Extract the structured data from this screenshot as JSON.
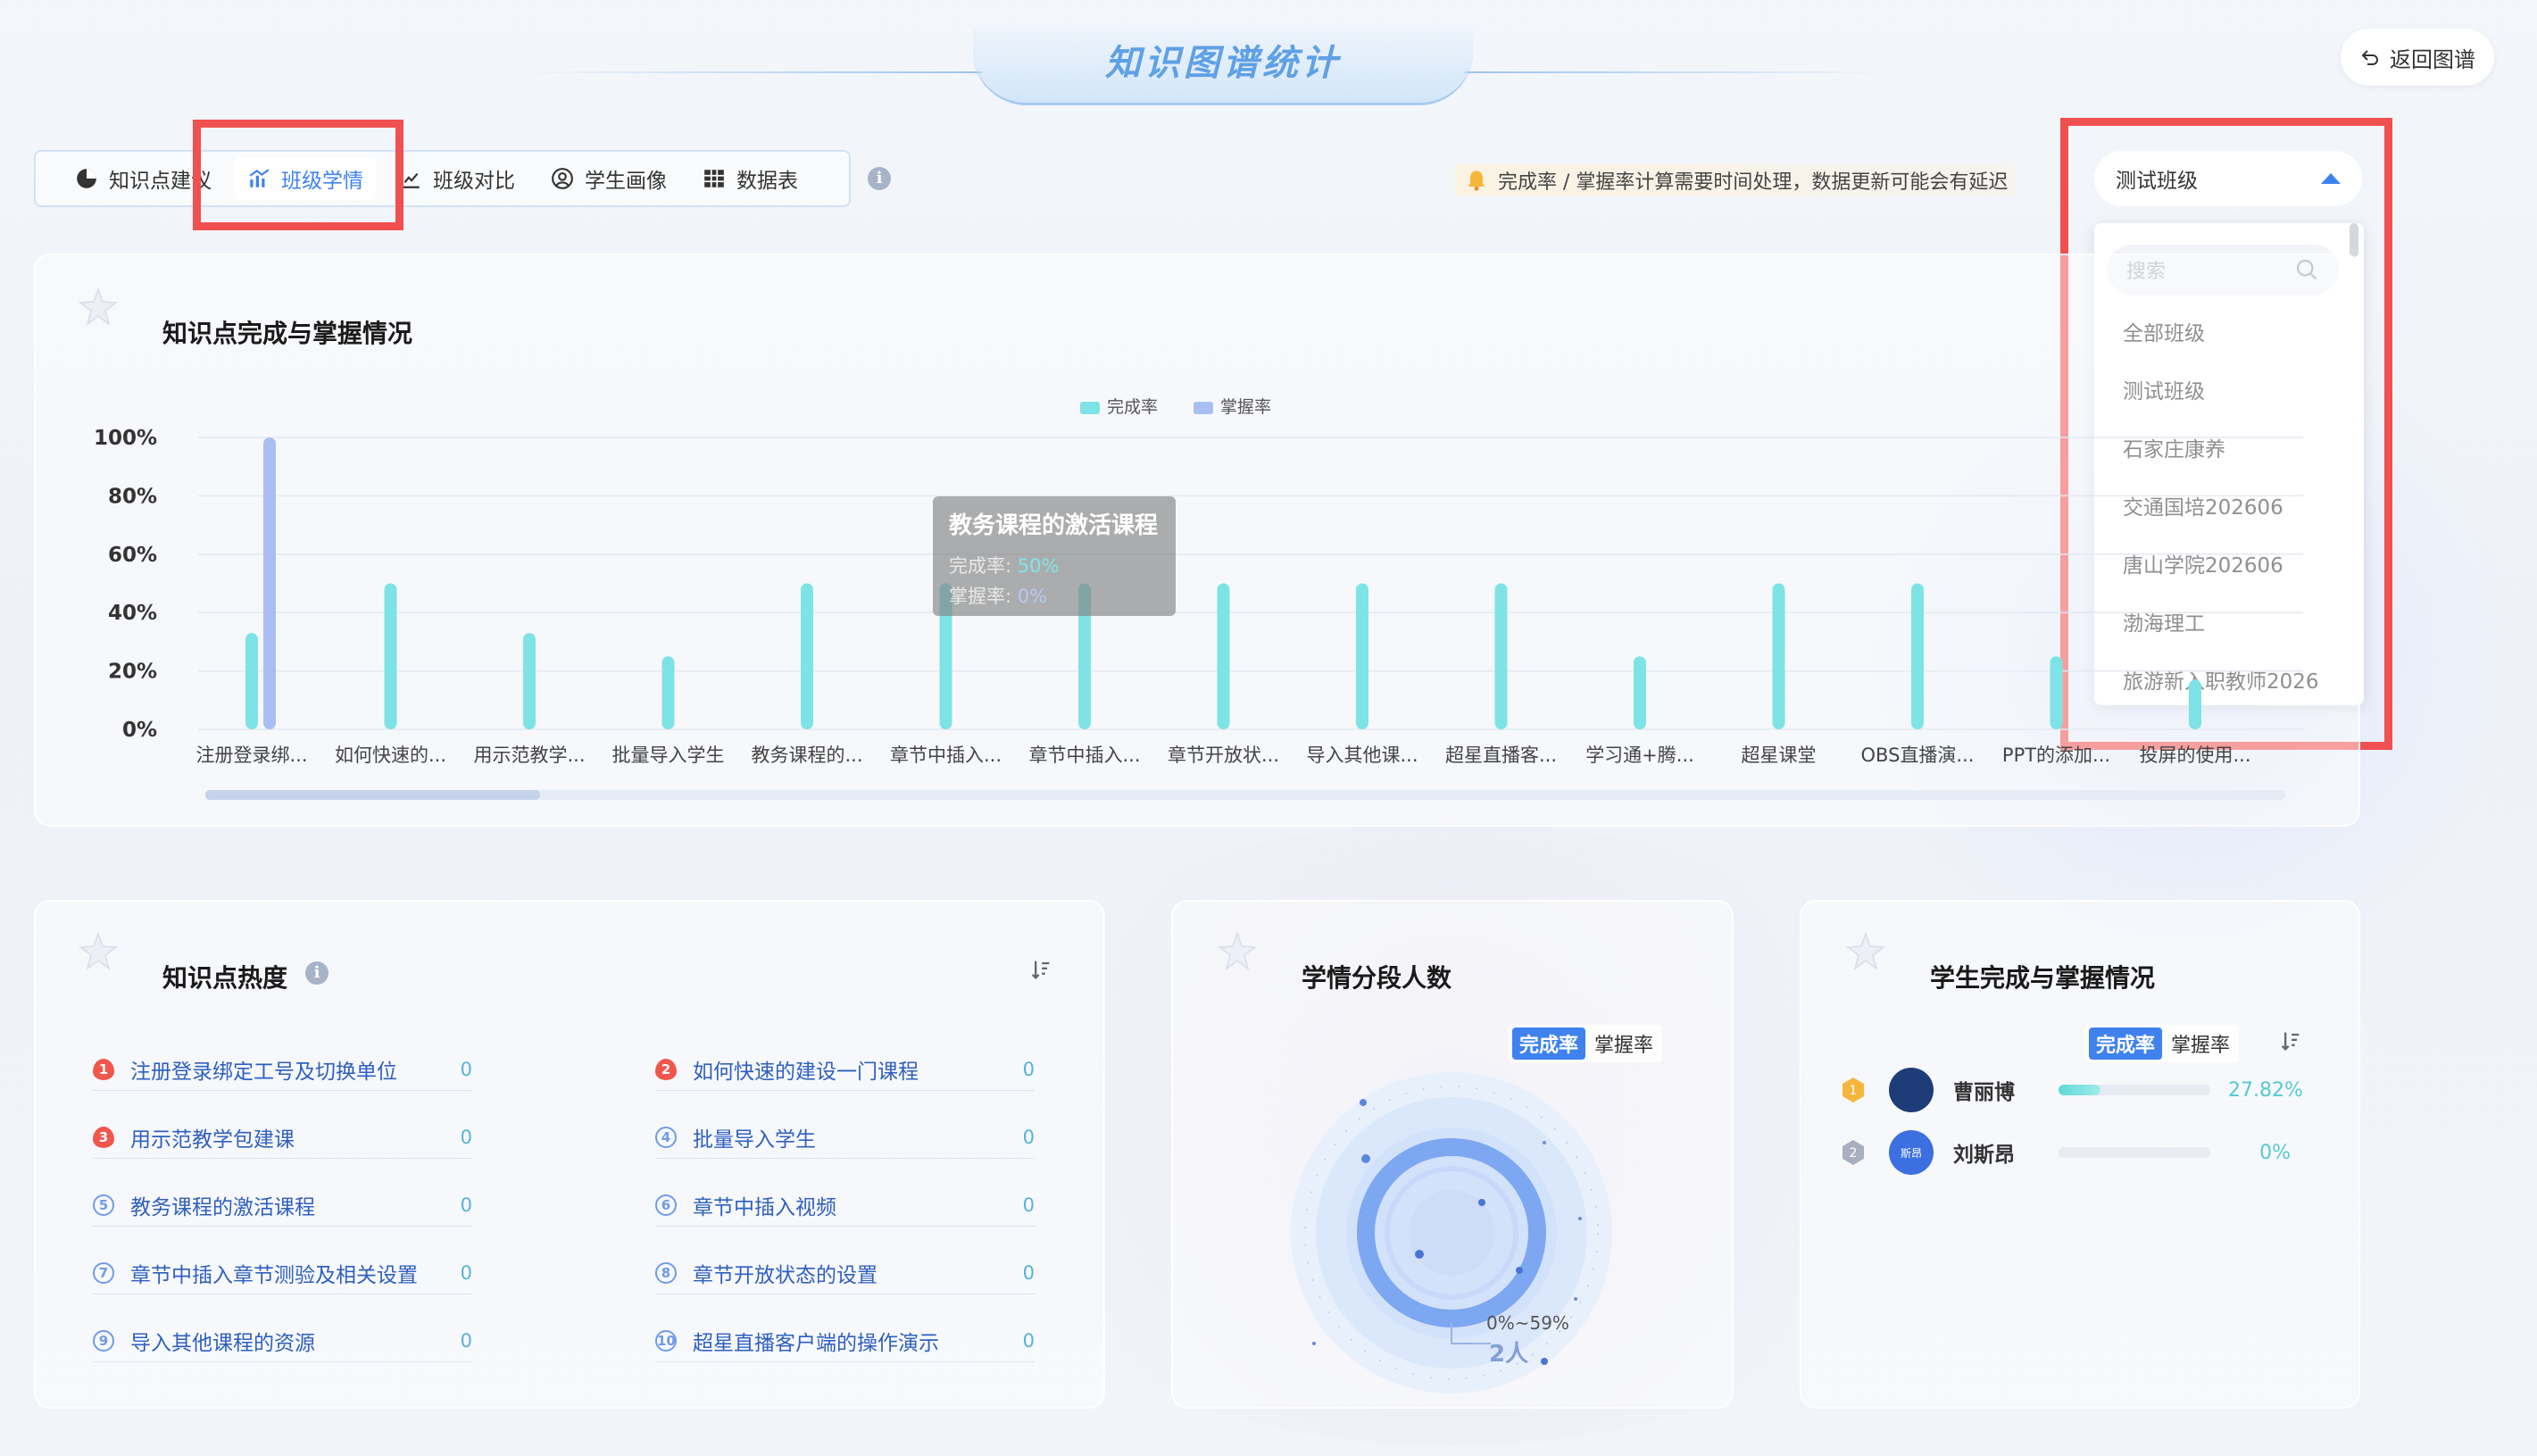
{
  "header": {
    "title": "知识图谱统计",
    "back_label": "返回图谱"
  },
  "tabs": [
    {
      "label": "知识点建议",
      "icon": "pie-chart-icon",
      "active": false
    },
    {
      "label": "班级学情",
      "icon": "bar-chart-icon",
      "active": true
    },
    {
      "label": "班级对比",
      "icon": "line-chart-icon",
      "active": false
    },
    {
      "label": "学生画像",
      "icon": "user-circle-icon",
      "active": false
    },
    {
      "label": "数据表",
      "icon": "table-icon",
      "active": false
    }
  ],
  "notice": "完成率 / 掌握率计算需要时间处理，数据更新可能会有延迟",
  "class_select": {
    "value": "测试班级",
    "search_placeholder": "搜索",
    "options": [
      "全部班级",
      "测试班级",
      "石家庄康养",
      "交通国培202606",
      "唐山学院202606",
      "渤海理工",
      "旅游新入职教师2026"
    ]
  },
  "completion_card": {
    "title": "知识点完成与掌握情况",
    "legend": {
      "completion": "完成率",
      "mastery": "掌握率"
    },
    "tooltip": {
      "title": "教务课程的激活课程",
      "completion_label": "完成率:",
      "completion_value": "50%",
      "mastery_label": "掌握率:",
      "mastery_value": "0%"
    }
  },
  "chart_data": {
    "type": "bar",
    "ylim": [
      0,
      100
    ],
    "yticks": [
      "100%",
      "80%",
      "60%",
      "40%",
      "20%",
      "0%"
    ],
    "categories": [
      "注册登录绑...",
      "如何快速的...",
      "用示范教学...",
      "批量导入学生",
      "教务课程的...",
      "章节中插入...",
      "章节中插入...",
      "章节开放状...",
      "导入其他课...",
      "超星直播客...",
      "学习通+腾...",
      "超星课堂",
      "OBS直播演...",
      "PPT的添加...",
      "投屏的使用..."
    ],
    "series": [
      {
        "name": "完成率",
        "color": "#7ee3e6",
        "values": [
          33,
          50,
          33,
          25,
          50,
          50,
          50,
          50,
          50,
          50,
          25,
          50,
          50,
          25,
          17
        ]
      },
      {
        "name": "掌握率",
        "color": "#a9bff3",
        "values": [
          100,
          0,
          0,
          0,
          0,
          0,
          0,
          0,
          0,
          0,
          0,
          0,
          0,
          0,
          0
        ]
      }
    ]
  },
  "heat_card": {
    "title": "知识点热度",
    "items": [
      {
        "rank": "1",
        "label": "注册登录绑定工号及切换单位",
        "value": "0"
      },
      {
        "rank": "2",
        "label": "如何快速的建设一门课程",
        "value": "0"
      },
      {
        "rank": "3",
        "label": "用示范教学包建课",
        "value": "0"
      },
      {
        "rank": "4",
        "label": "批量导入学生",
        "value": "0"
      },
      {
        "rank": "5",
        "label": "教务课程的激活课程",
        "value": "0"
      },
      {
        "rank": "6",
        "label": "章节中插入视频",
        "value": "0"
      },
      {
        "rank": "7",
        "label": "章节中插入章节测验及相关设置",
        "value": "0"
      },
      {
        "rank": "8",
        "label": "章节开放状态的设置",
        "value": "0"
      },
      {
        "rank": "9",
        "label": "导入其他课程的资源",
        "value": "0"
      },
      {
        "rank": "10",
        "label": "超星直播客户端的操作演示",
        "value": "0"
      }
    ]
  },
  "segment_card": {
    "title": "学情分段人数",
    "toggle_on": "完成率",
    "toggle_off": "掌握率",
    "ring_label": "0%~59%",
    "ring_count": "2人"
  },
  "student_card": {
    "title": "学生完成与掌握情况",
    "toggle_on": "完成率",
    "toggle_off": "掌握率",
    "students": [
      {
        "rank": "1",
        "name": "曹丽博",
        "avatar_text": "",
        "percent_label": "27.82%",
        "percent": 27.82
      },
      {
        "rank": "2",
        "name": "刘斯昂",
        "avatar_text": "斯昂",
        "percent_label": "0%",
        "percent": 0
      }
    ]
  }
}
